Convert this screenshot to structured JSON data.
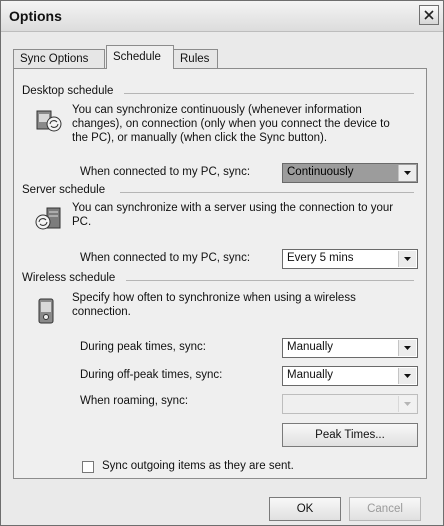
{
  "window": {
    "title": "Options"
  },
  "tabs": [
    {
      "label": "Sync Options",
      "active": false
    },
    {
      "label": "Schedule",
      "active": true
    },
    {
      "label": "Rules",
      "active": false
    }
  ],
  "desktop": {
    "heading": "Desktop schedule",
    "description": [
      "You can synchronize continuously (whenever information",
      "changes), on connection (only when you connect the device to",
      "the PC), or manually (when click the Sync button)."
    ],
    "label": "When connected to my PC, sync:",
    "value": "Continuously"
  },
  "server": {
    "heading": "Server schedule",
    "description": [
      "You can synchronize with a server using the connection to your",
      "PC."
    ],
    "label": "When connected to my PC, sync:",
    "value": "Every 5 mins"
  },
  "wireless": {
    "heading": "Wireless schedule",
    "description": [
      "Specify how often to synchronize when using a wireless",
      "connection."
    ],
    "peak_label": "During peak times, sync:",
    "peak_value": "Manually",
    "offpeak_label": "During off-peak times, sync:",
    "offpeak_value": "Manually",
    "roaming_label": "When roaming, sync:",
    "roaming_value": "",
    "peak_times_button": "Peak Times..."
  },
  "checkbox": {
    "label": "Sync outgoing items as they are sent.",
    "checked": false
  },
  "buttons": {
    "ok": "OK",
    "cancel": "Cancel"
  },
  "icons": {
    "close": "close-icon",
    "desktop": "desktop-sync-icon",
    "server": "server-sync-icon",
    "wireless": "wireless-device-icon",
    "dropdown": "chevron-down-icon"
  }
}
